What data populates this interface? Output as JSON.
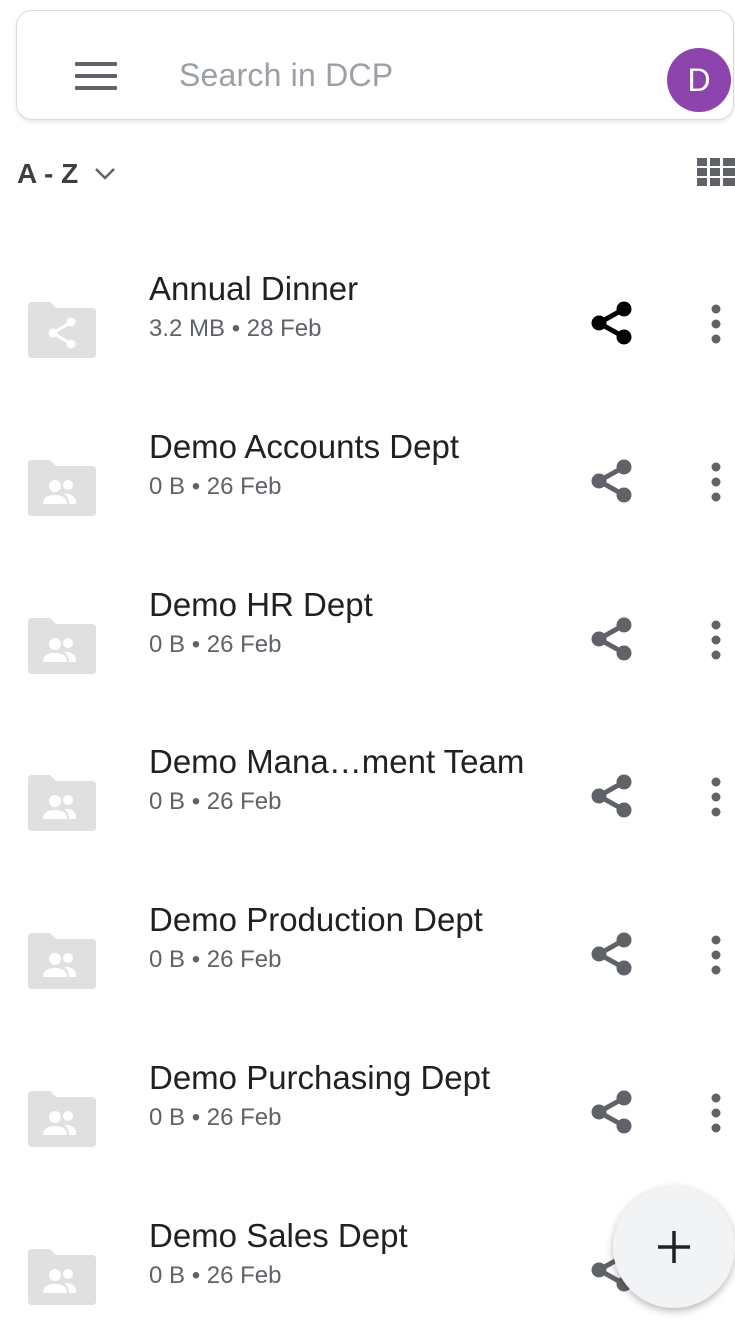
{
  "search": {
    "placeholder": "Search in DCP"
  },
  "user": {
    "avatar_letter": "D",
    "avatar_color": "#8e44ad"
  },
  "sort": {
    "label": "A - Z"
  },
  "icons": {
    "menu": "hamburger-menu-icon",
    "sort_toggle": "chevron-down-icon",
    "view_toggle": "grid-view-icon",
    "folder": "folder-icon",
    "share": "share-icon",
    "more": "more-vert-icon",
    "add": "plus-icon"
  },
  "items": [
    {
      "name": "Annual Dinner",
      "meta": "3.2 MB • 28 Feb",
      "folder_kind": "shared"
    },
    {
      "name": "Demo Accounts Dept",
      "meta": "0 B • 26 Feb",
      "folder_kind": "team"
    },
    {
      "name": "Demo HR Dept",
      "meta": "0 B • 26 Feb",
      "folder_kind": "team"
    },
    {
      "name": "Demo Mana…ment Team",
      "meta": "0 B • 26 Feb",
      "folder_kind": "team"
    },
    {
      "name": "Demo Production Dept",
      "meta": "0 B • 26 Feb",
      "folder_kind": "team"
    },
    {
      "name": "Demo Purchasing Dept",
      "meta": "0 B • 26 Feb",
      "folder_kind": "team"
    },
    {
      "name": "Demo Sales Dept",
      "meta": "0 B • 26 Feb",
      "folder_kind": "team"
    }
  ],
  "fab": {
    "label": "+"
  }
}
